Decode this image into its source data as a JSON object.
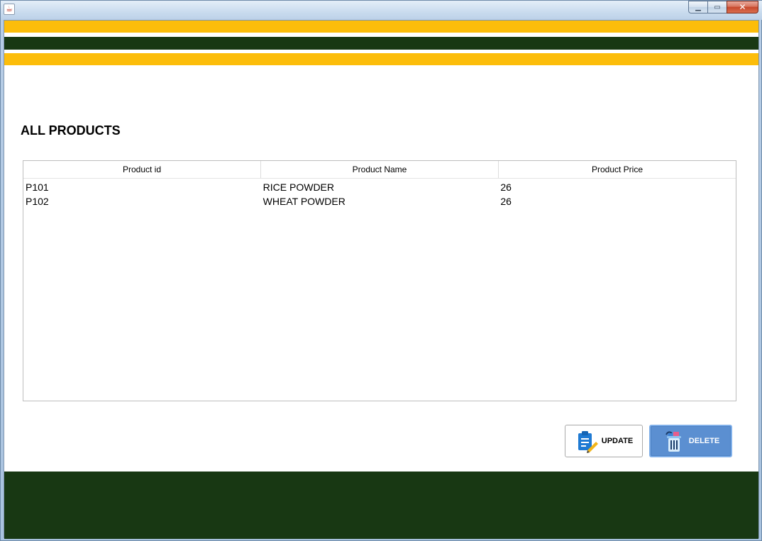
{
  "window": {
    "app_icon": "java-icon",
    "controls": {
      "minimize_icon": "minimize-icon",
      "maximize_icon": "maximize-icon",
      "close_icon": "close-icon"
    }
  },
  "colors": {
    "yellow": "#fcbd0a",
    "dark_green": "#183813",
    "delete_blue": "#5b8fd1"
  },
  "page": {
    "title": "ALL PRODUCTS"
  },
  "table": {
    "columns": [
      "Product id",
      "Product Name",
      "Product Price"
    ],
    "rows": [
      [
        "P101",
        "RICE POWDER",
        "26"
      ],
      [
        "P102",
        "WHEAT POWDER",
        "26"
      ]
    ]
  },
  "actions": {
    "update_label": "UPDATE",
    "update_icon": "clipboard-edit-icon",
    "delete_label": "DELETE",
    "delete_icon": "trash-bin-icon"
  }
}
